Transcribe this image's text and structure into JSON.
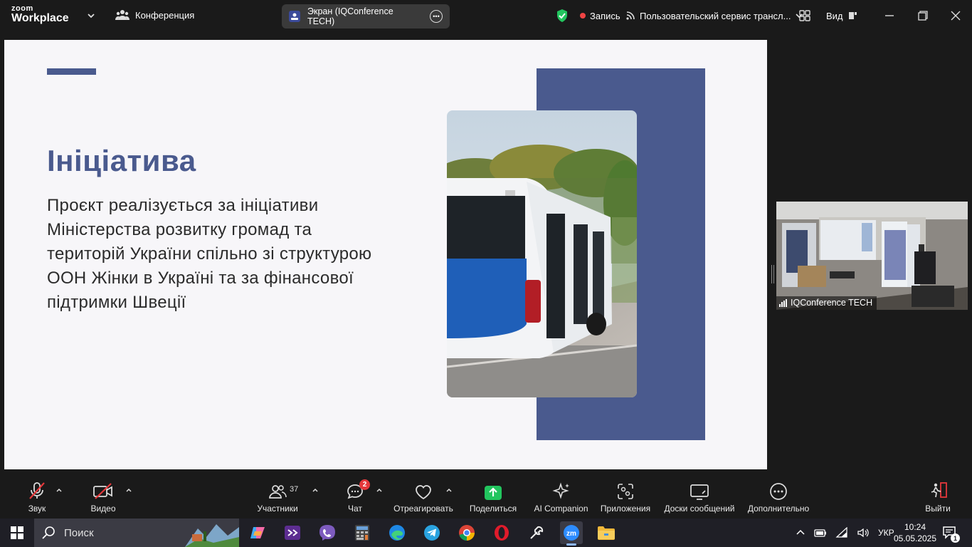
{
  "topbar": {
    "logo_line1": "zoom",
    "logo_line2": "Workplace",
    "meeting_label": "Конференция",
    "screen_share_label": "Экран (IQConference TECH)",
    "recording_label": "Запись",
    "stream_label": "Пользовательский сервис трансл...",
    "view_label": "Вид"
  },
  "slide": {
    "title": "Ініціатива",
    "body_lines": [
      "Проєкт реалізується за ініціативи",
      "Міністерства розвитку громад та",
      "територій України спільно зі структурою",
      "ООН Жінки в Україні та за фінансової",
      "підтримки Швеції"
    ],
    "accent_color": "#4a5a8e",
    "photo_icon": "bus-photo"
  },
  "video": {
    "participant_name": "IQConference TECH"
  },
  "toolbar": {
    "audio_label": "Звук",
    "video_label": "Видео",
    "participants_label": "Участники",
    "participants_count": "37",
    "chat_label": "Чат",
    "chat_badge": "2",
    "react_label": "Отреагировать",
    "share_label": "Поделиться",
    "ai_label": "AI Companion",
    "apps_label": "Приложения",
    "whiteboards_label": "Доски сообщений",
    "more_label": "Дополнительно",
    "leave_label": "Выйти"
  },
  "taskbar": {
    "search_label": "Поиск",
    "language": "УКР",
    "time": "10:24",
    "date": "05.05.2025",
    "notification_count": "1"
  },
  "colors": {
    "share_green": "#22c55e",
    "record_red": "#ef4444",
    "badge_red": "#e5383b",
    "slide_blue": "#4a5a8e"
  }
}
